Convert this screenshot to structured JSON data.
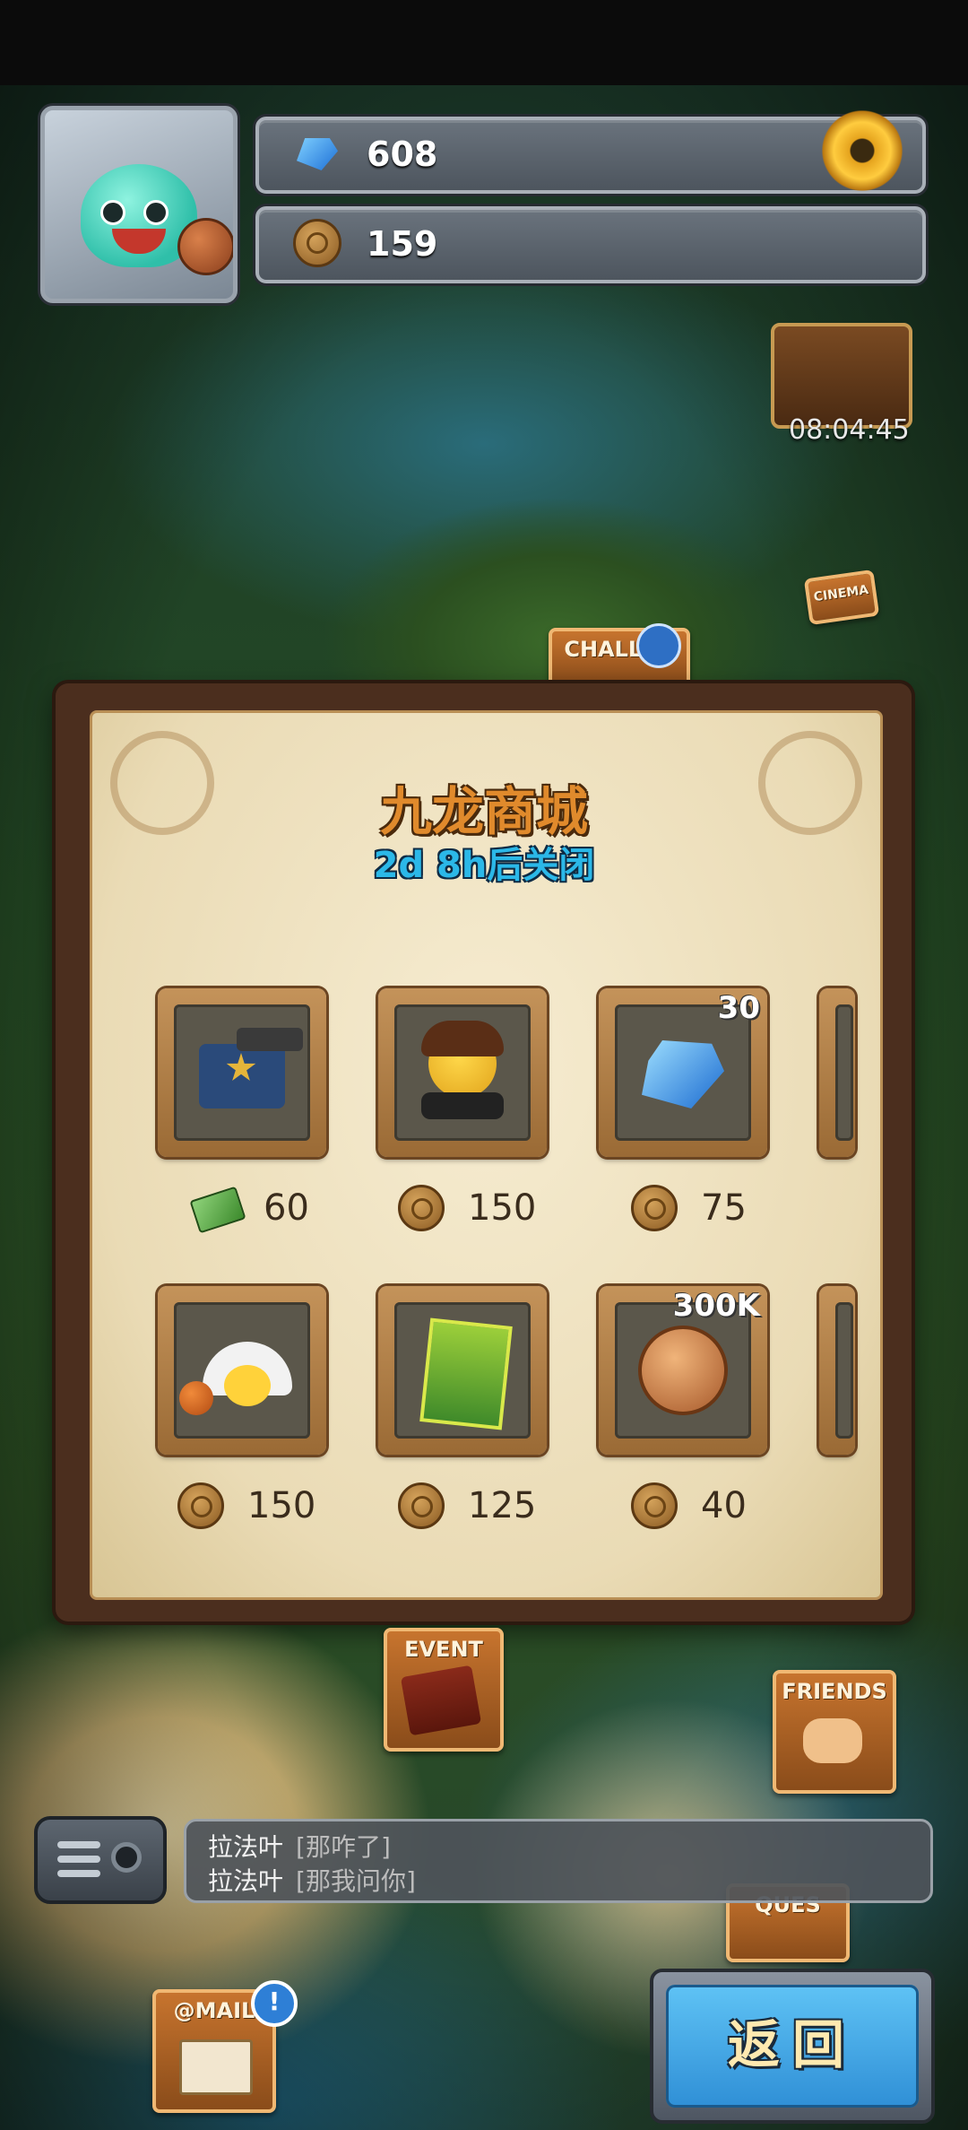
{
  "header": {
    "gems": "608",
    "coins": "159",
    "chest_timer": "08:04:45"
  },
  "map_labels": {
    "challenge": "CHALLEN",
    "cinema": "CINEMA",
    "event": "EVENT",
    "friends": "FRIENDS",
    "quest": "QUES",
    "email": "@MAIL"
  },
  "shop": {
    "title": "九龙商城",
    "subtitle": "2d 8h后关闭",
    "items": [
      {
        "icon": "police-badge-gun-icon",
        "quantity": "",
        "price": "60",
        "currency": "cash"
      },
      {
        "icon": "rocker-chick-costume-icon",
        "quantity": "",
        "price": "150",
        "currency": "coin"
      },
      {
        "icon": "blue-gem-icon",
        "quantity": "30",
        "price": "75",
        "currency": "coin"
      },
      {
        "icon": "basketball-chick-icon",
        "quantity": "",
        "price": "150",
        "currency": "coin"
      },
      {
        "icon": "discovery-magazine-icon",
        "quantity": "",
        "price": "125",
        "currency": "coin"
      },
      {
        "icon": "bronze-coin-icon",
        "quantity": "300K",
        "price": "40",
        "currency": "coin"
      }
    ]
  },
  "chat": {
    "lines": [
      {
        "name": "拉法叶",
        "msg": "[那咋了]"
      },
      {
        "name": "拉法叶",
        "msg": "[那我问你]"
      }
    ]
  },
  "back_button": "返回",
  "colors": {
    "title_orange": "#e08a2c",
    "subtitle_blue": "#2bb8e8",
    "back_blue": "#2f8fd6"
  }
}
